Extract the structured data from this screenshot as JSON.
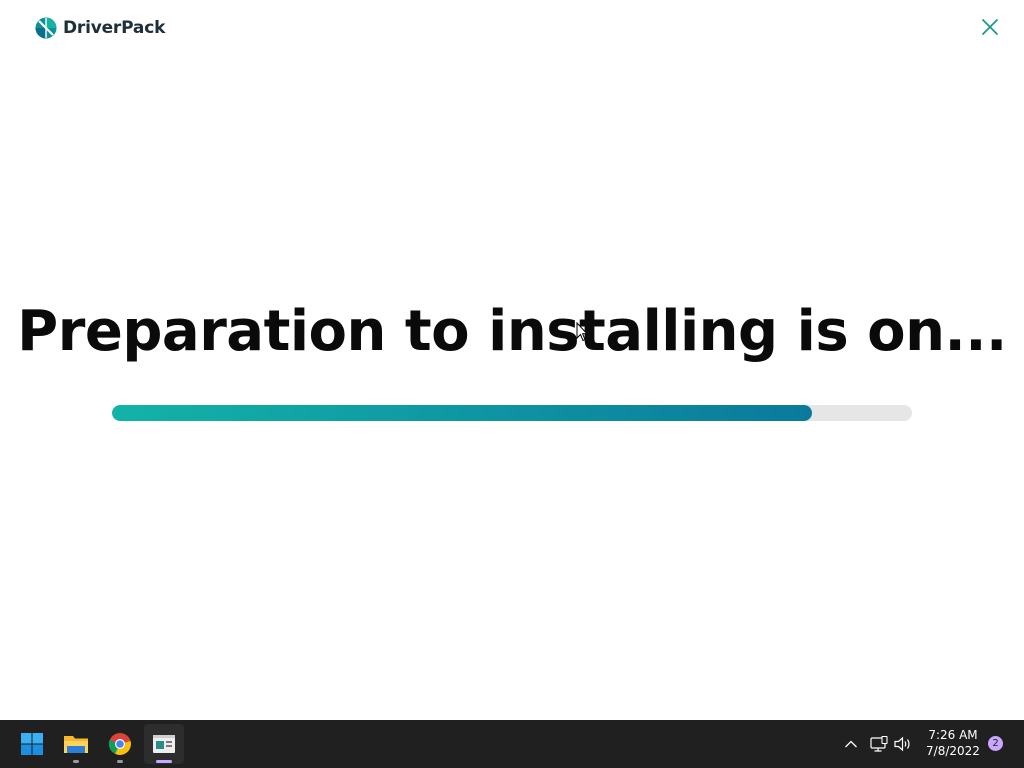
{
  "app": {
    "brand_name": "DriverPack",
    "title": "Preparation to installing is on...",
    "progress": 0.875
  },
  "colors": {
    "accent": "#13b3a6",
    "accent_dark": "#0a7a9c",
    "track": "#e6e6e6",
    "close_icon": "#1a9a8e",
    "taskbar": "#202020"
  },
  "icons": {
    "brand_logo": "driverpack-logo-icon",
    "close": "close-icon",
    "start": "windows-start-icon",
    "explorer": "file-explorer-icon",
    "chrome": "chrome-icon",
    "active_app": "driverpack-app-icon",
    "tray_overflow": "chevron-up-icon",
    "network": "network-icon",
    "volume": "volume-icon"
  },
  "taskbar": {
    "time": "7:26 AM",
    "date": "7/8/2022",
    "notifications": "2"
  }
}
